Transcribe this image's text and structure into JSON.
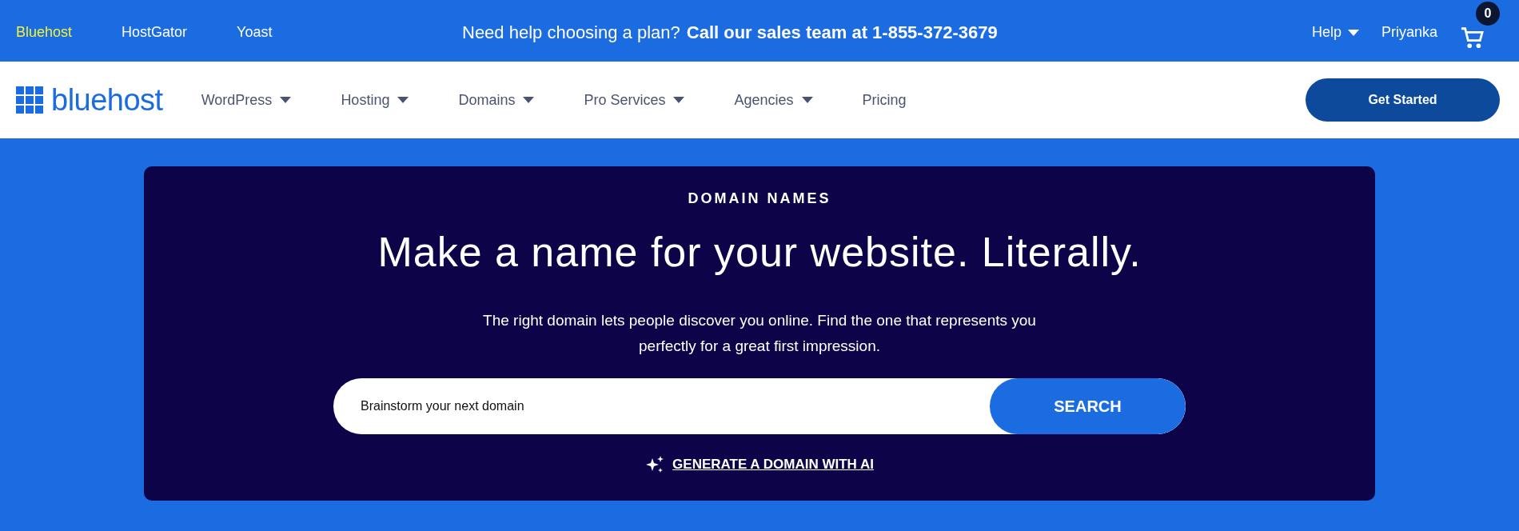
{
  "top_bar": {
    "brands": [
      {
        "label": "Bluehost",
        "selected": true
      },
      {
        "label": "HostGator",
        "selected": false
      },
      {
        "label": "Yoast",
        "selected": false
      }
    ],
    "promo": {
      "question": "Need help choosing a plan?",
      "call": "Call our sales team at 1-855-372-3679"
    },
    "help": "Help",
    "user": "Priyanka",
    "cart_count": "0"
  },
  "nav": {
    "logo": "bluehost",
    "items": [
      {
        "label": "WordPress",
        "dropdown": true
      },
      {
        "label": "Hosting",
        "dropdown": true
      },
      {
        "label": "Domains",
        "dropdown": true
      },
      {
        "label": "Pro Services",
        "dropdown": true
      },
      {
        "label": "Agencies",
        "dropdown": true
      },
      {
        "label": "Pricing",
        "dropdown": false
      }
    ],
    "cta": "Get Started"
  },
  "hero": {
    "eyebrow": "DOMAIN NAMES",
    "title": "Make a name for your website. Literally.",
    "description": "The right domain lets people discover you online. Find the one that represents you perfectly for a great first impression.",
    "search": {
      "placeholder": "Brainstorm your next domain",
      "button": "SEARCH"
    },
    "ai_link": "GENERATE A DOMAIN WITH AI"
  }
}
